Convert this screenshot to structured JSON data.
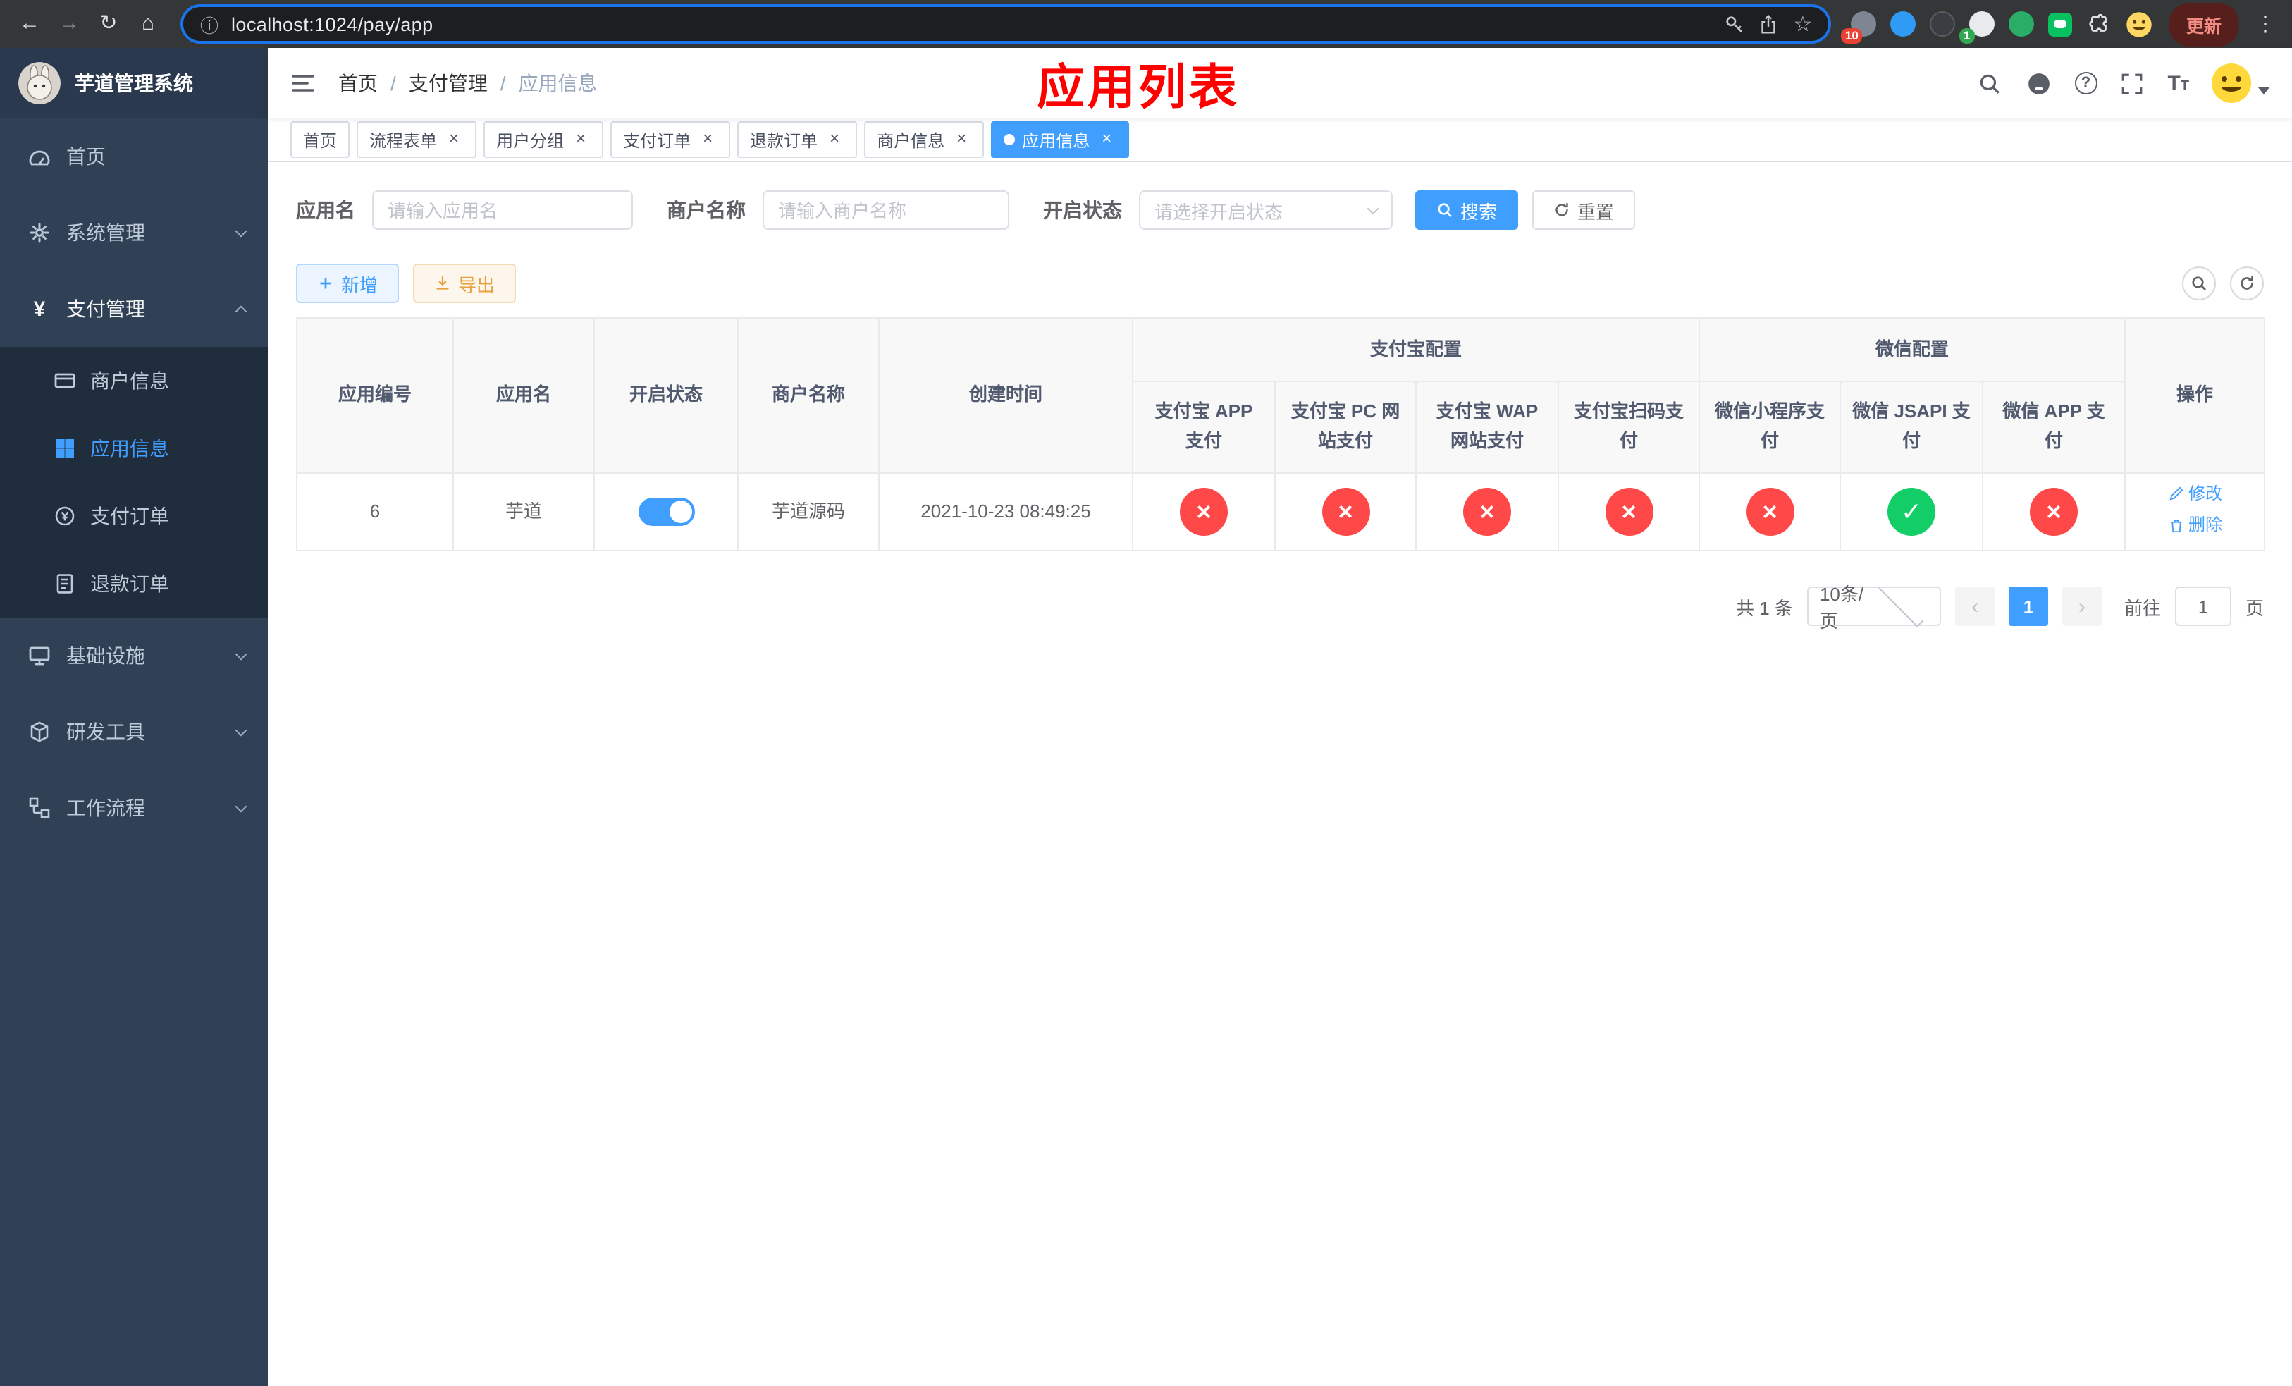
{
  "browser": {
    "url": "localhost:1024/pay/app",
    "update_label": "更新",
    "extension_badges": {
      "first": "10",
      "fourth": "1"
    }
  },
  "icons": {
    "back": "←",
    "forward": "→",
    "reload": "↻",
    "home": "⌂",
    "info": "ⓘ",
    "star": "☆",
    "kebab": "⋮",
    "close": "×",
    "check": "✓",
    "cross": "×",
    "prev": "‹",
    "next": "›",
    "yen": "¥"
  },
  "sidebar": {
    "app_title": "芋道管理系统",
    "menu": {
      "home": "首页",
      "system": "系统管理",
      "payment": "支付管理",
      "merchant_info": "商户信息",
      "app_info": "应用信息",
      "pay_order": "支付订单",
      "refund_order": "退款订单",
      "infra": "基础设施",
      "dev_tools": "研发工具",
      "workflow": "工作流程"
    }
  },
  "navbar": {
    "breadcrumb": [
      "首页",
      "支付管理",
      "应用信息"
    ],
    "separator": "/",
    "annotation_title": "应用列表"
  },
  "tabs": [
    {
      "label": "首页"
    },
    {
      "label": "流程表单"
    },
    {
      "label": "用户分组"
    },
    {
      "label": "支付订单"
    },
    {
      "label": "退款订单"
    },
    {
      "label": "商户信息"
    },
    {
      "label": "应用信息"
    }
  ],
  "filters": {
    "app_name_label": "应用名",
    "app_name_placeholder": "请输入应用名",
    "merchant_label": "商户名称",
    "merchant_placeholder": "请输入商户名称",
    "status_label": "开启状态",
    "status_placeholder": "请选择开启状态",
    "search_label": "搜索",
    "reset_label": "重置"
  },
  "toolbar": {
    "add_label": "新增",
    "export_label": "导出"
  },
  "table": {
    "headers": {
      "app_id": "应用编号",
      "app_name": "应用名",
      "status": "开启状态",
      "merchant_name": "商户名称",
      "create_time": "创建时间",
      "alipay_group": "支付宝配置",
      "alipay_app": "支付宝 APP 支付",
      "alipay_pc": "支付宝 PC 网站支付",
      "alipay_wap": "支付宝 WAP 网站支付",
      "alipay_qr": "支付宝扫码支付",
      "wx_group": "微信配置",
      "wx_lite": "微信小程序支付",
      "wx_jsapi": "微信 JSAPI 支付",
      "wx_app": "微信 APP 支付",
      "ops": "操作"
    },
    "rows": [
      {
        "app_id": "6",
        "app_name": "芋道",
        "status_on": true,
        "merchant_name": "芋道源码",
        "create_time": "2021-10-23 08:49:25",
        "alipay_app": "fail",
        "alipay_pc": "fail",
        "alipay_wap": "fail",
        "alipay_qr": "fail",
        "wx_lite": "fail",
        "wx_jsapi": "ok",
        "wx_app": "fail",
        "edit_label": "修改",
        "delete_label": "删除"
      }
    ]
  },
  "pagination": {
    "total": "共 1 条",
    "page_size": "10条/页",
    "current_page": "1",
    "goto_label": "前往",
    "goto_value": "1",
    "page_unit": "页"
  },
  "colors": {
    "primary": "#409eff",
    "success": "#13ce66",
    "danger": "#ff4949",
    "sidebar_bg": "#304156",
    "submenu_bg": "#1f2d3d",
    "annotation": "#ff0000"
  }
}
